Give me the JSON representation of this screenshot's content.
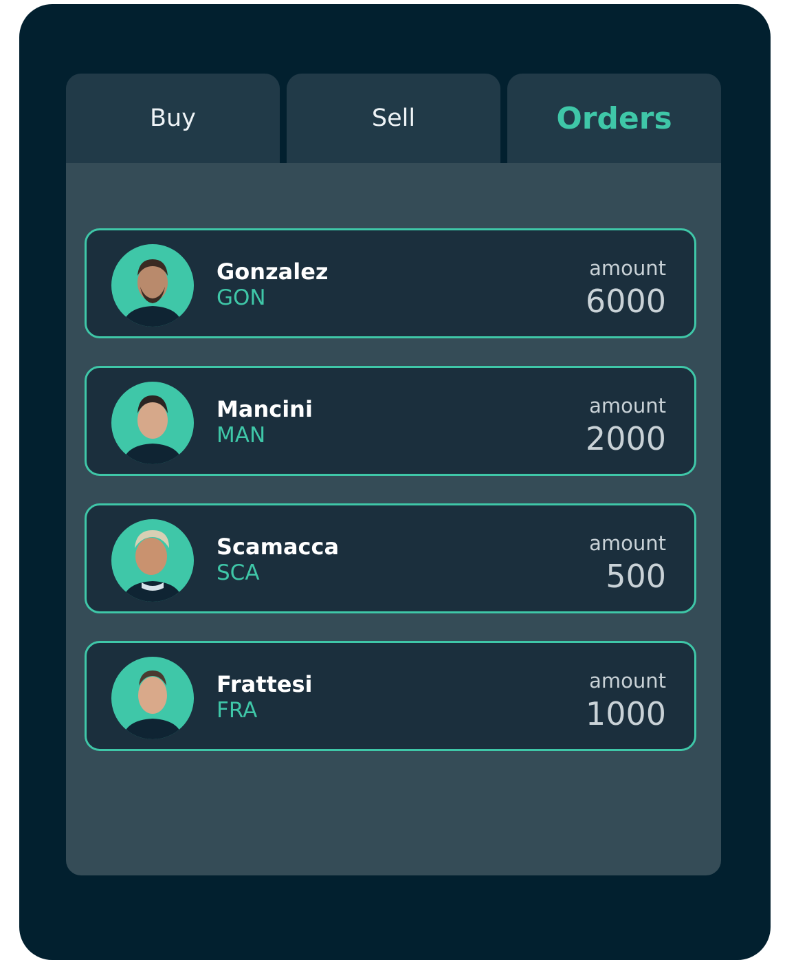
{
  "tabs": [
    {
      "label": "Buy",
      "active": false
    },
    {
      "label": "Sell",
      "active": false
    },
    {
      "label": "Orders",
      "active": true
    }
  ],
  "orders": [
    {
      "name": "Gonzalez",
      "code": "GON",
      "amount_label": "amount",
      "amount": "6000"
    },
    {
      "name": "Mancini",
      "code": "MAN",
      "amount_label": "amount",
      "amount": "2000"
    },
    {
      "name": "Scamacca",
      "code": "SCA",
      "amount_label": "amount",
      "amount": "500"
    },
    {
      "name": "Frattesi",
      "code": "FRA",
      "amount_label": "amount",
      "amount": "1000"
    }
  ],
  "colors": {
    "background": "#02202f",
    "tab": "#213a48",
    "panel": "#354c57",
    "card": "#1b2f3d",
    "accent": "#3fc7a8",
    "amount_text": "#c9d2d7"
  }
}
